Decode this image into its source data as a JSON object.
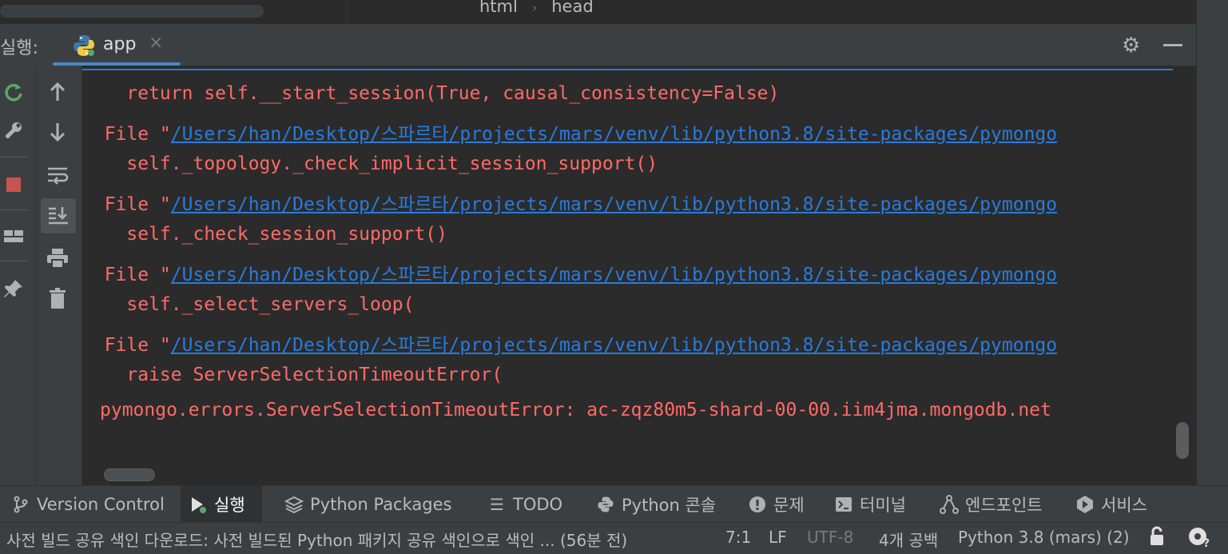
{
  "editor": {
    "breadcrumb": [
      "html",
      "head"
    ],
    "breadcrumb_sep": "›"
  },
  "run_panel": {
    "label": "실행:",
    "tab": {
      "label": "app",
      "close": "×",
      "icon": "python-icon"
    },
    "actions": {
      "settings": "gear-icon",
      "minimize": "minimize-icon"
    }
  },
  "console": {
    "lines": [
      {
        "text": "    return self.__start_session(True, causal_consistency=False)"
      },
      {
        "prefix": "  File \"",
        "link": "/Users/han/Desktop/스파르타/projects/mars/venv/lib/python3.8/site-packages/pymongo"
      },
      {
        "text": "    self._topology._check_implicit_session_support()"
      },
      {
        "prefix": "  File \"",
        "link": "/Users/han/Desktop/스파르타/projects/mars/venv/lib/python3.8/site-packages/pymongo"
      },
      {
        "text": "    self._check_session_support()"
      },
      {
        "prefix": "  File \"",
        "link": "/Users/han/Desktop/스파르타/projects/mars/venv/lib/python3.8/site-packages/pymongo"
      },
      {
        "text": "    self._select_servers_loop("
      },
      {
        "prefix": "  File \"",
        "link": "/Users/han/Desktop/스파르타/projects/mars/venv/lib/python3.8/site-packages/pymongo"
      },
      {
        "text": "    raise ServerSelectionTimeoutError("
      },
      {
        "text": "pymongo.errors.ServerSelectionTimeoutError: ac-zqz80m5-shard-00-00.iim4jma.mongodb.net"
      }
    ],
    "colors": {
      "error": "#ff6b68",
      "link": "#287bde",
      "background": "#2b2b2b"
    }
  },
  "tool_windows": [
    {
      "label": "Version Control",
      "icon": "branch-icon"
    },
    {
      "label": "실행",
      "icon": "run-icon",
      "active": true
    },
    {
      "label": "Python Packages",
      "icon": "layers-icon"
    },
    {
      "label": "TODO",
      "icon": "list-icon"
    },
    {
      "label": "Python 콘솔",
      "icon": "python-console-icon"
    },
    {
      "label": "문제",
      "icon": "problems-icon"
    },
    {
      "label": "터미널",
      "icon": "terminal-icon"
    },
    {
      "label": "엔드포인트",
      "icon": "endpoints-icon"
    },
    {
      "label": "서비스",
      "icon": "services-icon"
    }
  ],
  "status_bar": {
    "message": "사전 빌드 공유 색인 다운로드: 사전 빌드된 Python 패키지 공유 색인으로 색인 ... (56분 전)",
    "position": "7:1",
    "line_separator": "LF",
    "encoding": "UTF-8",
    "indent": "4개 공백",
    "interpreter": "Python 3.8 (mars) (2)"
  }
}
